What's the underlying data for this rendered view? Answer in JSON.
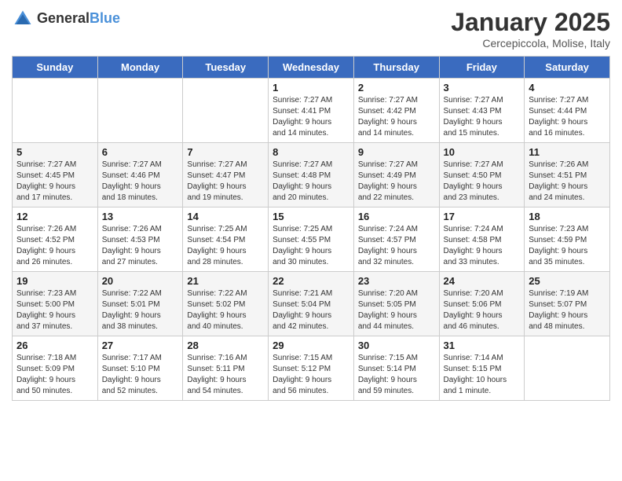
{
  "header": {
    "logo_general": "General",
    "logo_blue": "Blue",
    "month_title": "January 2025",
    "subtitle": "Cercepiccola, Molise, Italy"
  },
  "days_of_week": [
    "Sunday",
    "Monday",
    "Tuesday",
    "Wednesday",
    "Thursday",
    "Friday",
    "Saturday"
  ],
  "weeks": [
    [
      {
        "day": "",
        "info": ""
      },
      {
        "day": "",
        "info": ""
      },
      {
        "day": "",
        "info": ""
      },
      {
        "day": "1",
        "info": "Sunrise: 7:27 AM\nSunset: 4:41 PM\nDaylight: 9 hours\nand 14 minutes."
      },
      {
        "day": "2",
        "info": "Sunrise: 7:27 AM\nSunset: 4:42 PM\nDaylight: 9 hours\nand 14 minutes."
      },
      {
        "day": "3",
        "info": "Sunrise: 7:27 AM\nSunset: 4:43 PM\nDaylight: 9 hours\nand 15 minutes."
      },
      {
        "day": "4",
        "info": "Sunrise: 7:27 AM\nSunset: 4:44 PM\nDaylight: 9 hours\nand 16 minutes."
      }
    ],
    [
      {
        "day": "5",
        "info": "Sunrise: 7:27 AM\nSunset: 4:45 PM\nDaylight: 9 hours\nand 17 minutes."
      },
      {
        "day": "6",
        "info": "Sunrise: 7:27 AM\nSunset: 4:46 PM\nDaylight: 9 hours\nand 18 minutes."
      },
      {
        "day": "7",
        "info": "Sunrise: 7:27 AM\nSunset: 4:47 PM\nDaylight: 9 hours\nand 19 minutes."
      },
      {
        "day": "8",
        "info": "Sunrise: 7:27 AM\nSunset: 4:48 PM\nDaylight: 9 hours\nand 20 minutes."
      },
      {
        "day": "9",
        "info": "Sunrise: 7:27 AM\nSunset: 4:49 PM\nDaylight: 9 hours\nand 22 minutes."
      },
      {
        "day": "10",
        "info": "Sunrise: 7:27 AM\nSunset: 4:50 PM\nDaylight: 9 hours\nand 23 minutes."
      },
      {
        "day": "11",
        "info": "Sunrise: 7:26 AM\nSunset: 4:51 PM\nDaylight: 9 hours\nand 24 minutes."
      }
    ],
    [
      {
        "day": "12",
        "info": "Sunrise: 7:26 AM\nSunset: 4:52 PM\nDaylight: 9 hours\nand 26 minutes."
      },
      {
        "day": "13",
        "info": "Sunrise: 7:26 AM\nSunset: 4:53 PM\nDaylight: 9 hours\nand 27 minutes."
      },
      {
        "day": "14",
        "info": "Sunrise: 7:25 AM\nSunset: 4:54 PM\nDaylight: 9 hours\nand 28 minutes."
      },
      {
        "day": "15",
        "info": "Sunrise: 7:25 AM\nSunset: 4:55 PM\nDaylight: 9 hours\nand 30 minutes."
      },
      {
        "day": "16",
        "info": "Sunrise: 7:24 AM\nSunset: 4:57 PM\nDaylight: 9 hours\nand 32 minutes."
      },
      {
        "day": "17",
        "info": "Sunrise: 7:24 AM\nSunset: 4:58 PM\nDaylight: 9 hours\nand 33 minutes."
      },
      {
        "day": "18",
        "info": "Sunrise: 7:23 AM\nSunset: 4:59 PM\nDaylight: 9 hours\nand 35 minutes."
      }
    ],
    [
      {
        "day": "19",
        "info": "Sunrise: 7:23 AM\nSunset: 5:00 PM\nDaylight: 9 hours\nand 37 minutes."
      },
      {
        "day": "20",
        "info": "Sunrise: 7:22 AM\nSunset: 5:01 PM\nDaylight: 9 hours\nand 38 minutes."
      },
      {
        "day": "21",
        "info": "Sunrise: 7:22 AM\nSunset: 5:02 PM\nDaylight: 9 hours\nand 40 minutes."
      },
      {
        "day": "22",
        "info": "Sunrise: 7:21 AM\nSunset: 5:04 PM\nDaylight: 9 hours\nand 42 minutes."
      },
      {
        "day": "23",
        "info": "Sunrise: 7:20 AM\nSunset: 5:05 PM\nDaylight: 9 hours\nand 44 minutes."
      },
      {
        "day": "24",
        "info": "Sunrise: 7:20 AM\nSunset: 5:06 PM\nDaylight: 9 hours\nand 46 minutes."
      },
      {
        "day": "25",
        "info": "Sunrise: 7:19 AM\nSunset: 5:07 PM\nDaylight: 9 hours\nand 48 minutes."
      }
    ],
    [
      {
        "day": "26",
        "info": "Sunrise: 7:18 AM\nSunset: 5:09 PM\nDaylight: 9 hours\nand 50 minutes."
      },
      {
        "day": "27",
        "info": "Sunrise: 7:17 AM\nSunset: 5:10 PM\nDaylight: 9 hours\nand 52 minutes."
      },
      {
        "day": "28",
        "info": "Sunrise: 7:16 AM\nSunset: 5:11 PM\nDaylight: 9 hours\nand 54 minutes."
      },
      {
        "day": "29",
        "info": "Sunrise: 7:15 AM\nSunset: 5:12 PM\nDaylight: 9 hours\nand 56 minutes."
      },
      {
        "day": "30",
        "info": "Sunrise: 7:15 AM\nSunset: 5:14 PM\nDaylight: 9 hours\nand 59 minutes."
      },
      {
        "day": "31",
        "info": "Sunrise: 7:14 AM\nSunset: 5:15 PM\nDaylight: 10 hours\nand 1 minute."
      },
      {
        "day": "",
        "info": ""
      }
    ]
  ]
}
